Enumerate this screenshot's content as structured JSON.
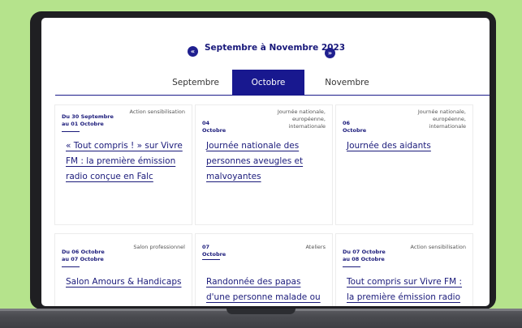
{
  "period": {
    "title": "Septembre à Novembre 2023",
    "prev_icon": "«",
    "next_icon": "»"
  },
  "tabs": [
    {
      "label": "Septembre",
      "active": false
    },
    {
      "label": "Octobre",
      "active": true
    },
    {
      "label": "Novembre",
      "active": false
    }
  ],
  "events": [
    {
      "date_line1": "Du 30 Septembre",
      "date_line2": "au 01 Octobre",
      "category": "Action sensibilisation",
      "title": "« Tout compris ! » sur Vivre FM : la première émission radio conçue en Falc"
    },
    {
      "date_line1": "04",
      "date_line2": "Octobre",
      "category": "Journée nationale, européenne, internationale",
      "title": "Journée nationale des personnes aveugles et malvoyantes"
    },
    {
      "date_line1": "06",
      "date_line2": "Octobre",
      "category": "Journée nationale, européenne, internationale",
      "title": "Journée des aidants"
    },
    {
      "date_line1": "Du 06 Octobre",
      "date_line2": "au 07 Octobre",
      "category": "Salon professionnel",
      "title": "Salon Amours & Handicaps"
    },
    {
      "date_line1": "07",
      "date_line2": "Octobre",
      "category": "Ateliers",
      "title": "Randonnée des papas d'une personne malade ou"
    },
    {
      "date_line1": "Du 07 Octobre",
      "date_line2": "au 08 Octobre",
      "category": "Action sensibilisation",
      "title": "Tout compris sur Vivre FM : la première émission radio"
    }
  ],
  "colors": {
    "background": "#b5e38c",
    "accent": "#18188f",
    "text_link": "#1a1a7a"
  }
}
